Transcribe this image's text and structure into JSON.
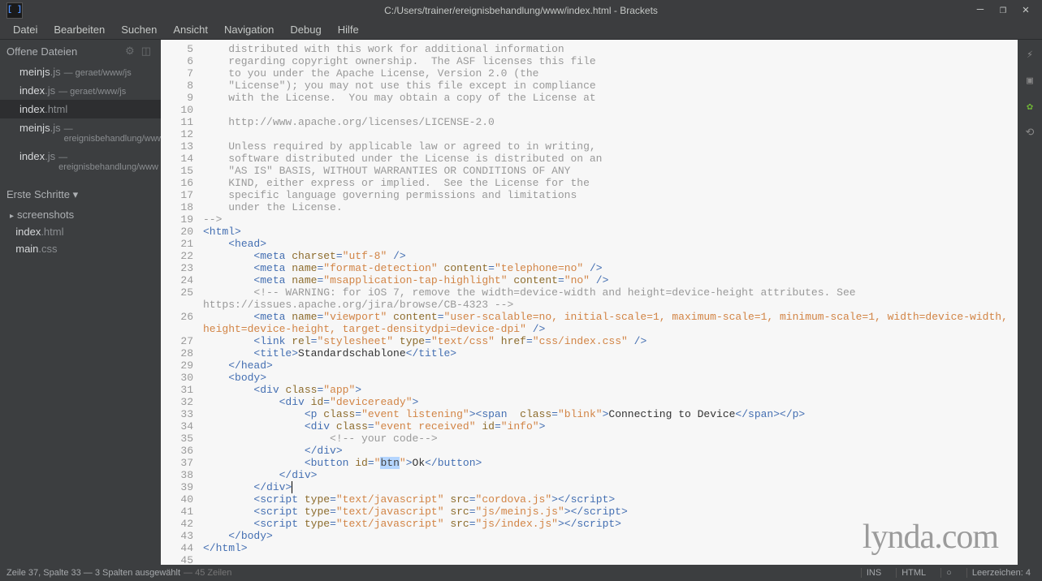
{
  "window": {
    "title": "C:/Users/trainer/ereignisbehandlung/www/index.html - Brackets",
    "min_icon": "—",
    "restore_icon": "❐",
    "close_icon": "✕"
  },
  "menubar": [
    "Datei",
    "Bearbeiten",
    "Suchen",
    "Ansicht",
    "Navigation",
    "Debug",
    "Hilfe"
  ],
  "sidebar": {
    "open_files_header": "Offene Dateien",
    "open_files": [
      {
        "name": "meinjs",
        "ext": ".js",
        "meta": " — geraet/www/js",
        "active": false
      },
      {
        "name": "index",
        "ext": ".js",
        "meta": " — geraet/www/js",
        "active": false
      },
      {
        "name": "index",
        "ext": ".html",
        "meta": "",
        "active": true
      },
      {
        "name": "meinjs",
        "ext": ".js",
        "meta": " — ereignisbehandlung/www",
        "active": false
      },
      {
        "name": "index",
        "ext": ".js",
        "meta": " — ereignisbehandlung/www",
        "active": false
      }
    ],
    "project_header": "Erste Schritte ▾",
    "tree": [
      {
        "label": "screenshots",
        "is_folder": true
      },
      {
        "name": "index",
        "ext": ".html",
        "is_folder": false
      },
      {
        "name": "main",
        "ext": ".css",
        "is_folder": false
      }
    ]
  },
  "editor": {
    "first_line_no": 5,
    "lines": [
      {
        "tokens": [
          {
            "t": "c-comment",
            "v": "    distributed with this work for additional information"
          }
        ]
      },
      {
        "tokens": [
          {
            "t": "c-comment",
            "v": "    regarding copyright ownership.  The ASF licenses this file"
          }
        ]
      },
      {
        "tokens": [
          {
            "t": "c-comment",
            "v": "    to you under the Apache License, Version 2.0 (the"
          }
        ]
      },
      {
        "tokens": [
          {
            "t": "c-comment",
            "v": "    \"License\"); you may not use this file except in compliance"
          }
        ]
      },
      {
        "tokens": [
          {
            "t": "c-comment",
            "v": "    with the License.  You may obtain a copy of the License at"
          }
        ]
      },
      {
        "tokens": []
      },
      {
        "tokens": [
          {
            "t": "c-comment",
            "v": "    http://www.apache.org/licenses/LICENSE-2.0"
          }
        ]
      },
      {
        "tokens": []
      },
      {
        "tokens": [
          {
            "t": "c-comment",
            "v": "    Unless required by applicable law or agreed to in writing,"
          }
        ]
      },
      {
        "tokens": [
          {
            "t": "c-comment",
            "v": "    software distributed under the License is distributed on an"
          }
        ]
      },
      {
        "tokens": [
          {
            "t": "c-comment",
            "v": "    \"AS IS\" BASIS, WITHOUT WARRANTIES OR CONDITIONS OF ANY"
          }
        ]
      },
      {
        "tokens": [
          {
            "t": "c-comment",
            "v": "    KIND, either express or implied.  See the License for the"
          }
        ]
      },
      {
        "tokens": [
          {
            "t": "c-comment",
            "v": "    specific language governing permissions and limitations"
          }
        ]
      },
      {
        "tokens": [
          {
            "t": "c-comment",
            "v": "    under the License."
          }
        ]
      },
      {
        "tokens": [
          {
            "t": "c-comment",
            "v": "-->"
          }
        ]
      },
      {
        "tokens": [
          {
            "t": "c-tag",
            "v": "<html>"
          }
        ]
      },
      {
        "tokens": [
          {
            "t": "c-text",
            "v": "    "
          },
          {
            "t": "c-tag",
            "v": "<head>"
          }
        ]
      },
      {
        "tokens": [
          {
            "t": "c-text",
            "v": "        "
          },
          {
            "t": "c-tag",
            "v": "<meta"
          },
          {
            "t": "c-text",
            "v": " "
          },
          {
            "t": "c-attr",
            "v": "charset"
          },
          {
            "t": "c-tag",
            "v": "="
          },
          {
            "t": "c-str",
            "v": "\"utf-8\""
          },
          {
            "t": "c-text",
            "v": " "
          },
          {
            "t": "c-tag",
            "v": "/>"
          }
        ]
      },
      {
        "tokens": [
          {
            "t": "c-text",
            "v": "        "
          },
          {
            "t": "c-tag",
            "v": "<meta"
          },
          {
            "t": "c-text",
            "v": " "
          },
          {
            "t": "c-attr",
            "v": "name"
          },
          {
            "t": "c-tag",
            "v": "="
          },
          {
            "t": "c-str",
            "v": "\"format-detection\""
          },
          {
            "t": "c-text",
            "v": " "
          },
          {
            "t": "c-attr",
            "v": "content"
          },
          {
            "t": "c-tag",
            "v": "="
          },
          {
            "t": "c-str",
            "v": "\"telephone=no\""
          },
          {
            "t": "c-text",
            "v": " "
          },
          {
            "t": "c-tag",
            "v": "/>"
          }
        ]
      },
      {
        "tokens": [
          {
            "t": "c-text",
            "v": "        "
          },
          {
            "t": "c-tag",
            "v": "<meta"
          },
          {
            "t": "c-text",
            "v": " "
          },
          {
            "t": "c-attr",
            "v": "name"
          },
          {
            "t": "c-tag",
            "v": "="
          },
          {
            "t": "c-str",
            "v": "\"msapplication-tap-highlight\""
          },
          {
            "t": "c-text",
            "v": " "
          },
          {
            "t": "c-attr",
            "v": "content"
          },
          {
            "t": "c-tag",
            "v": "="
          },
          {
            "t": "c-str",
            "v": "\"no\""
          },
          {
            "t": "c-text",
            "v": " "
          },
          {
            "t": "c-tag",
            "v": "/>"
          }
        ]
      },
      {
        "tokens": [
          {
            "t": "c-text",
            "v": "        "
          },
          {
            "t": "c-comment",
            "v": "<!-- WARNING: for iOS 7, remove the width=device-width and height=device-height attributes. See https://issues.apache.org/jira/browse/CB-4323 -->"
          }
        ],
        "wrap": true
      },
      {
        "tokens": [
          {
            "t": "c-text",
            "v": "        "
          },
          {
            "t": "c-tag",
            "v": "<meta"
          },
          {
            "t": "c-text",
            "v": " "
          },
          {
            "t": "c-attr",
            "v": "name"
          },
          {
            "t": "c-tag",
            "v": "="
          },
          {
            "t": "c-str",
            "v": "\"viewport\""
          },
          {
            "t": "c-text",
            "v": " "
          },
          {
            "t": "c-attr",
            "v": "content"
          },
          {
            "t": "c-tag",
            "v": "="
          },
          {
            "t": "c-str",
            "v": "\"user-scalable=no, initial-scale=1, maximum-scale=1, minimum-scale=1, width=device-width, height=device-height, target-densitydpi=device-dpi\""
          },
          {
            "t": "c-text",
            "v": " "
          },
          {
            "t": "c-tag",
            "v": "/>"
          }
        ],
        "wrap": true
      },
      {
        "tokens": [
          {
            "t": "c-text",
            "v": "        "
          },
          {
            "t": "c-tag",
            "v": "<link"
          },
          {
            "t": "c-text",
            "v": " "
          },
          {
            "t": "c-attr",
            "v": "rel"
          },
          {
            "t": "c-tag",
            "v": "="
          },
          {
            "t": "c-str",
            "v": "\"stylesheet\""
          },
          {
            "t": "c-text",
            "v": " "
          },
          {
            "t": "c-attr",
            "v": "type"
          },
          {
            "t": "c-tag",
            "v": "="
          },
          {
            "t": "c-str",
            "v": "\"text/css\""
          },
          {
            "t": "c-text",
            "v": " "
          },
          {
            "t": "c-attr",
            "v": "href"
          },
          {
            "t": "c-tag",
            "v": "="
          },
          {
            "t": "c-str",
            "v": "\"css/index.css\""
          },
          {
            "t": "c-text",
            "v": " "
          },
          {
            "t": "c-tag",
            "v": "/>"
          }
        ]
      },
      {
        "tokens": [
          {
            "t": "c-text",
            "v": "        "
          },
          {
            "t": "c-tag",
            "v": "<title>"
          },
          {
            "t": "c-text",
            "v": "Standardschablone"
          },
          {
            "t": "c-tag",
            "v": "</title>"
          }
        ]
      },
      {
        "tokens": [
          {
            "t": "c-text",
            "v": "    "
          },
          {
            "t": "c-tag",
            "v": "</head>"
          }
        ]
      },
      {
        "tokens": [
          {
            "t": "c-text",
            "v": "    "
          },
          {
            "t": "c-tag",
            "v": "<body>"
          }
        ]
      },
      {
        "tokens": [
          {
            "t": "c-text",
            "v": "        "
          },
          {
            "t": "c-tag",
            "v": "<div"
          },
          {
            "t": "c-text",
            "v": " "
          },
          {
            "t": "c-attr",
            "v": "class"
          },
          {
            "t": "c-tag",
            "v": "="
          },
          {
            "t": "c-str",
            "v": "\"app\""
          },
          {
            "t": "c-tag",
            "v": ">"
          }
        ]
      },
      {
        "tokens": [
          {
            "t": "c-text",
            "v": "            "
          },
          {
            "t": "c-tag",
            "v": "<div"
          },
          {
            "t": "c-text",
            "v": " "
          },
          {
            "t": "c-attr",
            "v": "id"
          },
          {
            "t": "c-tag",
            "v": "="
          },
          {
            "t": "c-str",
            "v": "\"deviceready\""
          },
          {
            "t": "c-tag",
            "v": ">"
          }
        ]
      },
      {
        "tokens": [
          {
            "t": "c-text",
            "v": "                "
          },
          {
            "t": "c-tag",
            "v": "<p"
          },
          {
            "t": "c-text",
            "v": " "
          },
          {
            "t": "c-attr",
            "v": "class"
          },
          {
            "t": "c-tag",
            "v": "="
          },
          {
            "t": "c-str",
            "v": "\"event listening\""
          },
          {
            "t": "c-tag",
            "v": ">"
          },
          {
            "t": "c-tag",
            "v": "<span"
          },
          {
            "t": "c-text",
            "v": "  "
          },
          {
            "t": "c-attr",
            "v": "class"
          },
          {
            "t": "c-tag",
            "v": "="
          },
          {
            "t": "c-str",
            "v": "\"blink\""
          },
          {
            "t": "c-tag",
            "v": ">"
          },
          {
            "t": "c-text",
            "v": "Connecting to Device"
          },
          {
            "t": "c-tag",
            "v": "</span></p>"
          }
        ]
      },
      {
        "tokens": [
          {
            "t": "c-text",
            "v": "                "
          },
          {
            "t": "c-tag",
            "v": "<div"
          },
          {
            "t": "c-text",
            "v": " "
          },
          {
            "t": "c-attr",
            "v": "class"
          },
          {
            "t": "c-tag",
            "v": "="
          },
          {
            "t": "c-str",
            "v": "\"event received\""
          },
          {
            "t": "c-text",
            "v": " "
          },
          {
            "t": "c-attr",
            "v": "id"
          },
          {
            "t": "c-tag",
            "v": "="
          },
          {
            "t": "c-str",
            "v": "\"info\""
          },
          {
            "t": "c-tag",
            "v": ">"
          }
        ]
      },
      {
        "tokens": [
          {
            "t": "c-text",
            "v": "                    "
          },
          {
            "t": "c-comment",
            "v": "<!-- your code-->"
          }
        ]
      },
      {
        "tokens": [
          {
            "t": "c-text",
            "v": "                "
          },
          {
            "t": "c-tag",
            "v": "</div>"
          }
        ]
      },
      {
        "tokens": [
          {
            "t": "c-text",
            "v": "                "
          },
          {
            "t": "c-tag",
            "v": "<button"
          },
          {
            "t": "c-text",
            "v": " "
          },
          {
            "t": "c-attr",
            "v": "id"
          },
          {
            "t": "c-tag",
            "v": "="
          },
          {
            "t": "c-str",
            "v": "\""
          },
          {
            "t": "c-sel",
            "v": "btn"
          },
          {
            "t": "c-str",
            "v": "\""
          },
          {
            "t": "c-tag",
            "v": ">"
          },
          {
            "t": "c-text",
            "v": "Ok"
          },
          {
            "t": "c-tag",
            "v": "</button>"
          }
        ]
      },
      {
        "tokens": [
          {
            "t": "c-text",
            "v": "            "
          },
          {
            "t": "c-tag",
            "v": "</div>"
          }
        ]
      },
      {
        "tokens": [
          {
            "t": "c-text",
            "v": "        "
          },
          {
            "t": "c-tag",
            "v": "</div>"
          },
          {
            "t": "cursor",
            "v": ""
          }
        ],
        "cursor_line": true
      },
      {
        "tokens": [
          {
            "t": "c-text",
            "v": "        "
          },
          {
            "t": "c-tag",
            "v": "<script"
          },
          {
            "t": "c-text",
            "v": " "
          },
          {
            "t": "c-attr",
            "v": "type"
          },
          {
            "t": "c-tag",
            "v": "="
          },
          {
            "t": "c-str",
            "v": "\"text/javascript\""
          },
          {
            "t": "c-text",
            "v": " "
          },
          {
            "t": "c-attr",
            "v": "src"
          },
          {
            "t": "c-tag",
            "v": "="
          },
          {
            "t": "c-str",
            "v": "\"cordova.js\""
          },
          {
            "t": "c-tag",
            "v": ">"
          },
          {
            "t": "c-tag",
            "v": "</script>"
          }
        ]
      },
      {
        "tokens": [
          {
            "t": "c-text",
            "v": "        "
          },
          {
            "t": "c-tag",
            "v": "<script"
          },
          {
            "t": "c-text",
            "v": " "
          },
          {
            "t": "c-attr",
            "v": "type"
          },
          {
            "t": "c-tag",
            "v": "="
          },
          {
            "t": "c-str",
            "v": "\"text/javascript\""
          },
          {
            "t": "c-text",
            "v": " "
          },
          {
            "t": "c-attr",
            "v": "src"
          },
          {
            "t": "c-tag",
            "v": "="
          },
          {
            "t": "c-str",
            "v": "\"js/meinjs.js\""
          },
          {
            "t": "c-tag",
            "v": ">"
          },
          {
            "t": "c-tag",
            "v": "</script>"
          }
        ]
      },
      {
        "tokens": [
          {
            "t": "c-text",
            "v": "        "
          },
          {
            "t": "c-tag",
            "v": "<script"
          },
          {
            "t": "c-text",
            "v": " "
          },
          {
            "t": "c-attr",
            "v": "type"
          },
          {
            "t": "c-tag",
            "v": "="
          },
          {
            "t": "c-str",
            "v": "\"text/javascript\""
          },
          {
            "t": "c-text",
            "v": " "
          },
          {
            "t": "c-attr",
            "v": "src"
          },
          {
            "t": "c-tag",
            "v": "="
          },
          {
            "t": "c-str",
            "v": "\"js/index.js\""
          },
          {
            "t": "c-tag",
            "v": ">"
          },
          {
            "t": "c-tag",
            "v": "</script>"
          }
        ]
      },
      {
        "tokens": [
          {
            "t": "c-text",
            "v": "    "
          },
          {
            "t": "c-tag",
            "v": "</body>"
          }
        ]
      },
      {
        "tokens": [
          {
            "t": "c-tag",
            "v": "</html>"
          }
        ]
      },
      {
        "tokens": []
      }
    ]
  },
  "statusbar": {
    "cursor": "Zeile 37, Spalte 33 — 3 Spalten ausgewählt",
    "total": " — 45 Zeilen",
    "mode": "INS",
    "lang": "HTML",
    "spaces": "Leerzeichen: 4"
  },
  "watermark": {
    "a": "lynda",
    "b": ".com"
  }
}
